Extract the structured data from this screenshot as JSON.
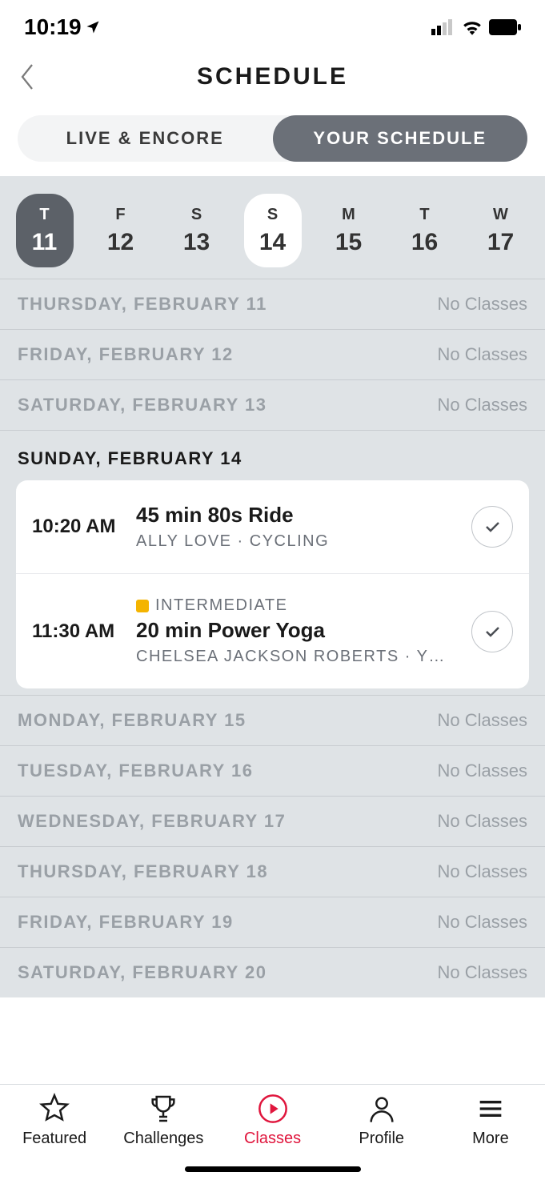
{
  "status": {
    "time": "10:19"
  },
  "header": {
    "title": "SCHEDULE"
  },
  "segments": {
    "left": "LIVE & ENCORE",
    "right": "YOUR SCHEDULE"
  },
  "dates": [
    {
      "dow": "T",
      "num": "11",
      "state": "selected"
    },
    {
      "dow": "F",
      "num": "12",
      "state": ""
    },
    {
      "dow": "S",
      "num": "13",
      "state": ""
    },
    {
      "dow": "S",
      "num": "14",
      "state": "highlight"
    },
    {
      "dow": "M",
      "num": "15",
      "state": ""
    },
    {
      "dow": "T",
      "num": "16",
      "state": ""
    },
    {
      "dow": "W",
      "num": "17",
      "state": ""
    }
  ],
  "no_classes": "No Classes",
  "days_before": [
    "THURSDAY, FEBRUARY 11",
    "FRIDAY, FEBRUARY 12",
    "SATURDAY, FEBRUARY 13"
  ],
  "active_day": "SUNDAY, FEBRUARY 14",
  "classes": [
    {
      "time": "10:20 AM",
      "level": "",
      "title": "45 min 80s Ride",
      "instructor": "ALLY LOVE",
      "category": "CYCLING"
    },
    {
      "time": "11:30 AM",
      "level": "INTERMEDIATE",
      "title": "20 min Power Yoga",
      "instructor": "CHELSEA JACKSON ROBERTS",
      "category": "Y…"
    }
  ],
  "days_after": [
    "MONDAY, FEBRUARY 15",
    "TUESDAY, FEBRUARY 16",
    "WEDNESDAY, FEBRUARY 17",
    "THURSDAY, FEBRUARY 18",
    "FRIDAY, FEBRUARY 19",
    "SATURDAY, FEBRUARY 20"
  ],
  "tabs": {
    "featured": "Featured",
    "challenges": "Challenges",
    "classes": "Classes",
    "profile": "Profile",
    "more": "More"
  }
}
